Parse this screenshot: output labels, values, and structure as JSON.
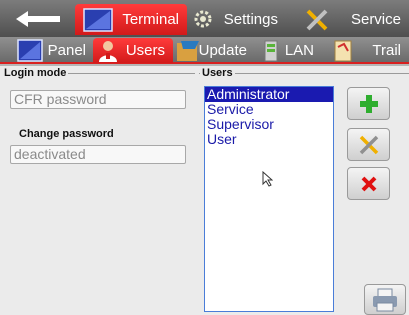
{
  "tabs_row1": {
    "terminal": "Terminal",
    "settings": "Settings",
    "service": "Service"
  },
  "tabs_row2": {
    "panel": "Panel",
    "users": "Users",
    "update": "Update",
    "lan": "LAN",
    "trail": "Trail"
  },
  "login": {
    "group_title": "Login mode",
    "mode_value": "CFR password",
    "change_password_label": "Change password",
    "change_password_value": "deactivated"
  },
  "users": {
    "group_title": "Users",
    "items": [
      "Administrator",
      "Service",
      "Supervisor",
      "User"
    ],
    "selected_index": 0
  },
  "colors": {
    "active_tab": "#e02020",
    "selection": "#1a1ab0",
    "add": "#2fae2f",
    "delete": "#e01010"
  },
  "icons": [
    "back-arrow-icon",
    "terminal-icon",
    "settings-gear-icon",
    "service-tools-icon",
    "panel-icon",
    "users-icon",
    "update-icon",
    "lan-icon",
    "trail-icon",
    "add-icon",
    "edit-tools-icon",
    "delete-icon",
    "print-icon",
    "mouse-cursor-icon"
  ]
}
